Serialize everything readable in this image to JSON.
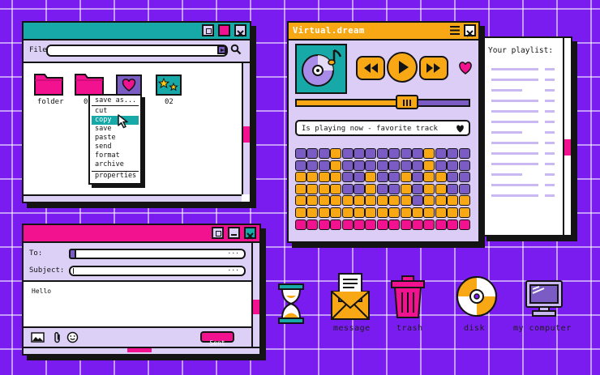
{
  "explorer": {
    "file_label": "File",
    "items": [
      {
        "label": "folder",
        "icon": "folder-icon"
      },
      {
        "label": "0",
        "icon": "folder-icon"
      },
      {
        "label": "",
        "icon": "heart-file-icon"
      },
      {
        "label": "02",
        "icon": "stars-file-icon"
      }
    ],
    "context_menu": [
      "save as...",
      "cut",
      "copy",
      "save",
      "paste",
      "send",
      "format",
      "archive",
      "properties"
    ],
    "selected_menu_item": "copy"
  },
  "player": {
    "title": "Virtual.dream",
    "now_playing": "Is playing now - favorite track",
    "colors": {
      "accent": "#f7a814",
      "purple": "#7a5cc4",
      "pink": "#f2128f"
    }
  },
  "playlist": {
    "title": "Your playlist:"
  },
  "mail": {
    "to_label": "To:",
    "subject_label": "Subject:",
    "body": "Hello",
    "send_label": "Sent"
  },
  "desktop": {
    "icons": [
      {
        "label": "",
        "icon": "hourglass-icon"
      },
      {
        "label": "message",
        "icon": "envelope-icon"
      },
      {
        "label": "trash",
        "icon": "trash-icon"
      },
      {
        "label": "disk",
        "icon": "disk-icon"
      },
      {
        "label": "my computer",
        "icon": "computer-icon"
      }
    ]
  }
}
